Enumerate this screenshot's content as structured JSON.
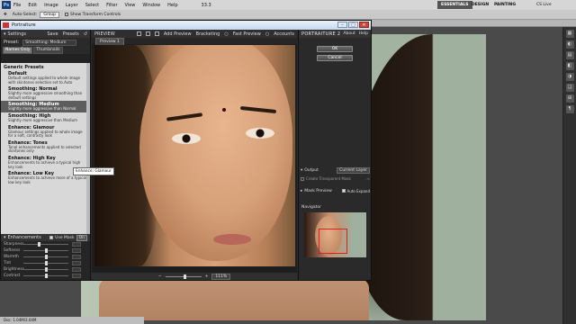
{
  "photoshop": {
    "logo": "Ps",
    "menu": [
      "File",
      "Edit",
      "Image",
      "Layer",
      "Select",
      "Filter",
      "View",
      "Window",
      "Help"
    ],
    "zoom": "33.3",
    "workspaces": [
      "ESSENTIALS",
      "DESIGN",
      "PAINTING"
    ],
    "cs_live": "CS Live",
    "options": {
      "auto_select": "Auto-Select:",
      "group": "Group",
      "show_transform": "Show Transform Controls"
    },
    "status": "Doc: 1.04M/3.04M"
  },
  "plugin": {
    "window_title": "Portraiture",
    "settings_label": "Settings",
    "save_label": "Save",
    "presets_label": "Presets",
    "preset_label": "Preset:",
    "preset_value": "Smoothing: Medium",
    "view_tabs": [
      "Names Only",
      "Thumbnails"
    ],
    "preset_groups": [
      {
        "name": "Generic Presets",
        "items": [
          {
            "title": "Default",
            "desc": "Default settings applied to whole image with skintones selection set to Auto"
          },
          {
            "title": "Smoothing: Normal",
            "desc": "Slightly more aggressive smoothing than default settings"
          },
          {
            "title": "Smoothing: Medium",
            "desc": "Slightly more aggressive than Normal",
            "active": true
          },
          {
            "title": "Smoothing: High",
            "desc": "Slightly more aggressive than Medium"
          },
          {
            "title": "Enhance: Glamour",
            "desc": "Glamour settings applied to whole image for a soft, contrasty look"
          },
          {
            "title": "Enhance: Tones",
            "desc": "Tonal enhancements applied to selected skintones only"
          },
          {
            "title": "Enhance: High Key",
            "desc": "Enhancements to achieve a typical high key look"
          },
          {
            "title": "Enhance: Low Key",
            "desc": "Enhancements to achieve more of a typical low key look"
          }
        ]
      }
    ],
    "enhancements_label": "Enhancements",
    "use_mask_label": "Use Mask",
    "on_label": "On",
    "sliders": [
      {
        "label": "Sharpness",
        "level": 0.35
      },
      {
        "label": "Softness",
        "level": 0.5
      },
      {
        "label": "Warmth",
        "level": 0.5
      },
      {
        "label": "Tint",
        "level": 0.5
      },
      {
        "label": "Brightness",
        "level": 0.5
      },
      {
        "label": "Contrast",
        "level": 0.5
      }
    ],
    "tooltip": "Enhance: Glamour",
    "preview_label": "PREVIEW",
    "add_preview_label": "Add Preview",
    "bracketing_label": "Bracketing",
    "fast_preview_label": "Fast Preview",
    "accounts_label": "Accounts",
    "preview_tab": "Preview 1",
    "zoom_value": "111%",
    "brand": "PORTRAITURE 2",
    "about_label": "About",
    "help_label": "Help",
    "ok_label": "OK",
    "cancel_label": "Cancel",
    "output_label": "Output",
    "output_value": "Current Layer",
    "create_transparent_label": "Create Transparent Mask",
    "mask_preview_label": "Mask Preview",
    "auto_expand_label": "Auto Expand",
    "navigator_label": "Navigator"
  }
}
